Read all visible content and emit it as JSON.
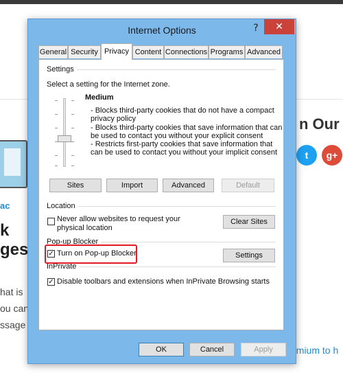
{
  "background": {
    "heading": "n Our C",
    "twitter_icon": "twitter-icon",
    "gplus_label": "g+",
    "link_text": "ac",
    "big_line1": "k",
    "big_line2": "ges",
    "small_line1": "hat is",
    "small_line2": "ou can",
    "small_line3": "ssage",
    "premium_link": "emium to h"
  },
  "dialog": {
    "title": "Internet Options",
    "help_label": "?",
    "close_label": "✕",
    "tabs": [
      {
        "label": "General",
        "active": false
      },
      {
        "label": "Security",
        "active": false
      },
      {
        "label": "Privacy",
        "active": true
      },
      {
        "label": "Content",
        "active": false
      },
      {
        "label": "Connections",
        "active": false
      },
      {
        "label": "Programs",
        "active": false
      },
      {
        "label": "Advanced",
        "active": false
      }
    ],
    "settings": {
      "group_label": "Settings",
      "select_text": "Select a setting for the Internet zone.",
      "level_name": "Medium",
      "description_lines": [
        "- Blocks third-party cookies that do not have a compact",
        "privacy policy",
        "- Blocks third-party cookies that save information that can",
        "be used to contact you without your explicit consent",
        "- Restricts first-party cookies that save information that",
        "can be used to contact you without your implicit consent"
      ],
      "buttons": {
        "sites": "Sites",
        "import": "Import",
        "advanced": "Advanced",
        "default": "Default"
      }
    },
    "location": {
      "group_label": "Location",
      "checkbox_label_line1": "Never allow websites to request your",
      "checkbox_label_line2": "physical location",
      "checked": false,
      "clear_sites_label": "Clear Sites"
    },
    "popup_blocker": {
      "group_label": "Pop-up Blocker",
      "checkbox_label": "Turn on Pop-up Blocker",
      "checked": true,
      "settings_label": "Settings"
    },
    "inprivate": {
      "group_label": "InPrivate",
      "checkbox_label": "Disable toolbars and extensions when InPrivate Browsing starts",
      "checked": true
    },
    "footer": {
      "ok": "OK",
      "cancel": "Cancel",
      "apply": "Apply"
    },
    "colors": {
      "frame": "#7cb8ea",
      "close_button": "#c9433b",
      "highlight": "#e01b24"
    }
  }
}
